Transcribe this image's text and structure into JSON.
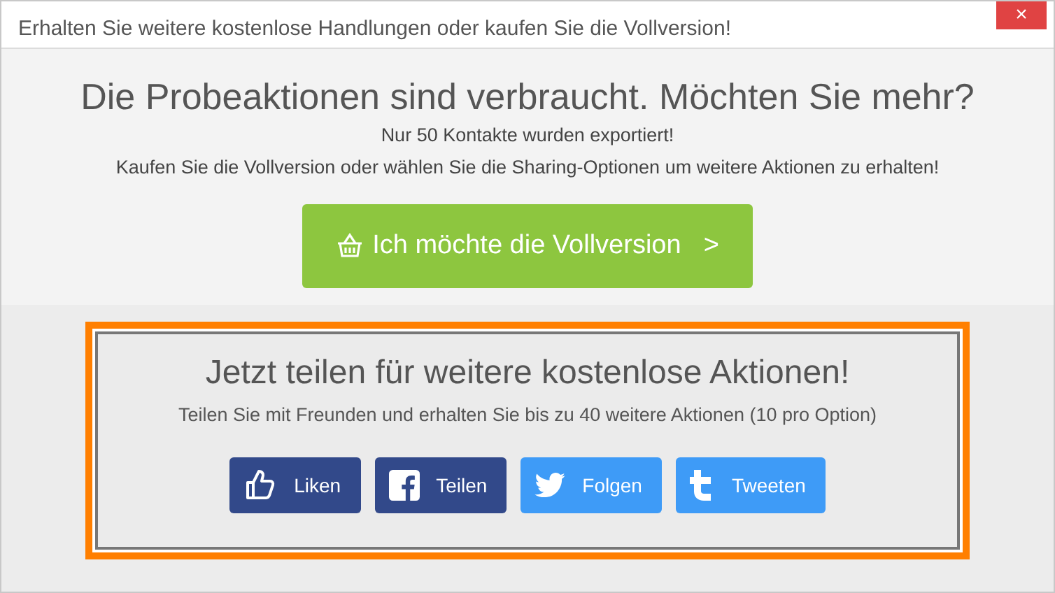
{
  "window": {
    "title": "Erhalten Sie weitere kostenlose Handlungen oder kaufen Sie die Vollversion!",
    "close": "×"
  },
  "headline": "Die Probeaktionen sind verbraucht. Möchten Sie mehr?",
  "lines": [
    "Nur 50 Kontakte wurden exportiert!",
    "Kaufen Sie die Vollversion oder wählen Sie die Sharing-Optionen um weitere Aktionen zu erhalten!"
  ],
  "buy_button": {
    "label": "Ich möchte die Vollversion",
    "chevron": ">"
  },
  "share": {
    "title": "Jetzt teilen für weitere kostenlose Aktionen!",
    "subtitle": "Teilen Sie mit Freunden und erhalten Sie bis zu 40 weitere Aktionen (10 pro Option)",
    "buttons": [
      {
        "kind": "like",
        "label": "Liken",
        "color": "#32498a"
      },
      {
        "kind": "facebook",
        "label": "Teilen",
        "color": "#32498a"
      },
      {
        "kind": "twitter",
        "label": "Folgen",
        "color": "#3e9bf7"
      },
      {
        "kind": "tumblr",
        "label": "Tweeten",
        "color": "#3e9bf7"
      }
    ]
  }
}
